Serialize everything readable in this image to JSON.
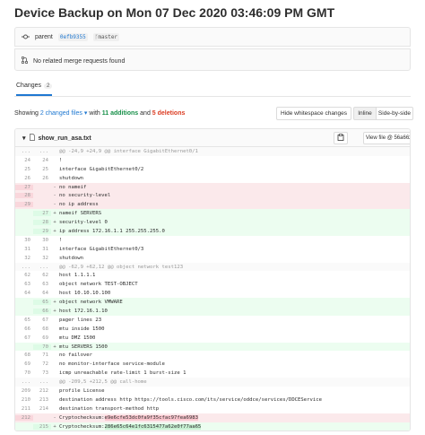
{
  "page": {
    "title": "Device Backup on Mon 07 Dec 2020 03:46:09 PM GMT"
  },
  "commit": {
    "parent_label": "parent",
    "parent_sha": "0efb9355",
    "branch": "master",
    "merge_requests": "No related merge requests found"
  },
  "tabs": [
    {
      "label": "Changes",
      "count": "2"
    }
  ],
  "summary": {
    "showing": "Showing",
    "files": "2 changed files",
    "with": "with",
    "additions": "11 additions",
    "and": "and",
    "deletions": "5 deletions"
  },
  "view_buttons": {
    "hide_whitespace": "Hide whitespace changes",
    "inline": "Inline",
    "side_by_side": "Side-by-side"
  },
  "file": {
    "name": "show_run_asa.txt",
    "view_label": "View file @ 56a6622e",
    "lines": [
      {
        "type": "hunk",
        "old": "...",
        "new": "...",
        "sign": "",
        "code": "@@ -24,9 +24,9 @@ interface GigabitEthernet0/1"
      },
      {
        "type": "ctx",
        "old": "24",
        "new": "24",
        "sign": "",
        "code": " !"
      },
      {
        "type": "ctx",
        "old": "25",
        "new": "25",
        "sign": "",
        "code": " interface GigabitEthernet0/2"
      },
      {
        "type": "ctx",
        "old": "26",
        "new": "26",
        "sign": "",
        "code": "  shutdown"
      },
      {
        "type": "old",
        "old": "27",
        "new": "",
        "sign": "-",
        "code": "  no nameif"
      },
      {
        "type": "old",
        "old": "28",
        "new": "",
        "sign": "-",
        "code": "  no security-level"
      },
      {
        "type": "old",
        "old": "29",
        "new": "",
        "sign": "-",
        "code": "  no ip address"
      },
      {
        "type": "new",
        "old": "",
        "new": "27",
        "sign": "+",
        "code": "  nameif SERVERS"
      },
      {
        "type": "new",
        "old": "",
        "new": "28",
        "sign": "+",
        "code": "  security-level 0"
      },
      {
        "type": "new",
        "old": "",
        "new": "29",
        "sign": "+",
        "code": "  ip address 172.16.1.1 255.255.255.0"
      },
      {
        "type": "ctx",
        "old": "30",
        "new": "30",
        "sign": "",
        "code": " !"
      },
      {
        "type": "ctx",
        "old": "31",
        "new": "31",
        "sign": "",
        "code": " interface GigabitEthernet0/3"
      },
      {
        "type": "ctx",
        "old": "32",
        "new": "32",
        "sign": "",
        "code": "  shutdown"
      },
      {
        "type": "hunk",
        "old": "...",
        "new": "...",
        "sign": "",
        "code": "@@ -62,9 +62,12 @@ object network test123"
      },
      {
        "type": "ctx",
        "old": "62",
        "new": "62",
        "sign": "",
        "code": "  host 1.1.1.1"
      },
      {
        "type": "ctx",
        "old": "63",
        "new": "63",
        "sign": "",
        "code": " object network TEST-OBJECT"
      },
      {
        "type": "ctx",
        "old": "64",
        "new": "64",
        "sign": "",
        "code": "  host 10.10.10.100"
      },
      {
        "type": "new",
        "old": "",
        "new": "65",
        "sign": "+",
        "code": " object network VMWARE"
      },
      {
        "type": "new",
        "old": "",
        "new": "66",
        "sign": "+",
        "code": "  host 172.16.1.10"
      },
      {
        "type": "ctx",
        "old": "65",
        "new": "67",
        "sign": "",
        "code": " pager lines 23"
      },
      {
        "type": "ctx",
        "old": "66",
        "new": "68",
        "sign": "",
        "code": " mtu inside 1500"
      },
      {
        "type": "ctx",
        "old": "67",
        "new": "69",
        "sign": "",
        "code": " mtu DMZ 1500"
      },
      {
        "type": "new",
        "old": "",
        "new": "70",
        "sign": "+",
        "code": " mtu SERVERS 1500"
      },
      {
        "type": "ctx",
        "old": "68",
        "new": "71",
        "sign": "",
        "code": " no failover"
      },
      {
        "type": "ctx",
        "old": "69",
        "new": "72",
        "sign": "",
        "code": " no monitor-interface service-module"
      },
      {
        "type": "ctx",
        "old": "70",
        "new": "73",
        "sign": "",
        "code": " icmp unreachable rate-limit 1 burst-size 1"
      },
      {
        "type": "hunk",
        "old": "...",
        "new": "...",
        "sign": "",
        "code": "@@ -209,5 +212,5 @@ call-home"
      },
      {
        "type": "ctx",
        "old": "209",
        "new": "212",
        "sign": "",
        "code": "  profile License"
      },
      {
        "type": "ctx",
        "old": "210",
        "new": "213",
        "sign": "",
        "code": "   destination address http https://tools.cisco.com/its/service/oddce/services/DDCEService"
      },
      {
        "type": "ctx",
        "old": "211",
        "new": "214",
        "sign": "",
        "code": "   destination transport-method http"
      },
      {
        "type": "old",
        "old": "212",
        "new": "",
        "sign": "-",
        "code": " Cryptochecksum:",
        "hl": "e9e6cfe53dc0fa9f35cfac97fea6983"
      },
      {
        "type": "new",
        "old": "",
        "new": "215",
        "sign": "+",
        "code": " Cryptochecksum:",
        "hl": "286e65c64e1fc6315477a62e0f77aa65"
      },
      {
        "type": "ctx",
        "old": "213",
        "new": "216",
        "sign": "",
        "code": " : end"
      },
      {
        "type": "hunk",
        "old": "",
        "new": "",
        "sign": "",
        "code": " \\ No newline at end of file"
      }
    ]
  },
  "colors": {
    "accent": "#1f78d1",
    "added": "#168f48",
    "deleted": "#db3b21"
  }
}
